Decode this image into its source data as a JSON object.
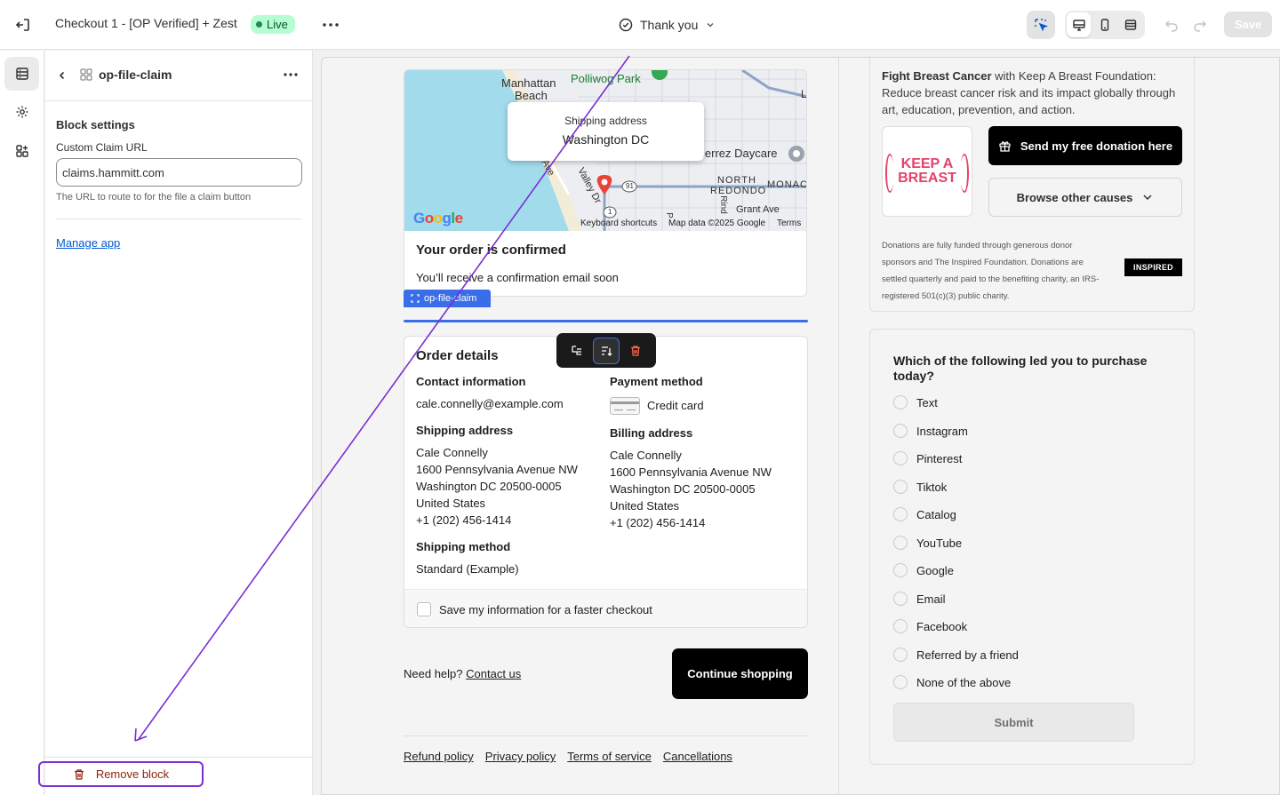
{
  "topbar": {
    "title": "Checkout 1 - [OP Verified] + Zest",
    "status_badge": "Live",
    "page_selector": "Thank you",
    "save_label": "Save"
  },
  "panel": {
    "block_name": "op-file-claim",
    "settings_title": "Block settings",
    "field_label": "Custom Claim URL",
    "field_value": "claims.hammitt.com",
    "field_help": "The URL to route to for the file a claim button",
    "manage_app": "Manage app",
    "remove_block": "Remove block"
  },
  "map": {
    "bubble_label": "Shipping address",
    "bubble_city": "Washington DC",
    "labels": {
      "manhattan": "Manhattan",
      "beach": "Beach",
      "polliwog": "Polliwog Park",
      "daycare": "ierrez Daycare",
      "north": "NORTH",
      "redondo": "REDONDO",
      "monac": "MONAC",
      "grant": "Grant Ave",
      "valley": "Valley Dr",
      "ave": "Ave",
      "rind": "Rind",
      "route": "91",
      "route2": "1",
      "l": "L",
      "p": "P"
    },
    "google": "Google",
    "attr_shortcuts": "Keyboard shortcuts",
    "attr_data": "Map data ©2025 Google",
    "attr_terms": "Terms"
  },
  "confirmation": {
    "title": "Your order is confirmed",
    "subtitle": "You’ll receive a confirmation email soon"
  },
  "block_tag": "op-file-claim",
  "order": {
    "title": "Order details",
    "contact_heading": "Contact information",
    "contact_email": "cale.connelly@example.com",
    "payment_heading": "Payment method",
    "payment_value": "Credit card",
    "shipping_heading": "Shipping address",
    "shipping_lines": [
      "Cale Connelly",
      "1600 Pennsylvania Avenue NW",
      "Washington DC 20500-0005",
      "United States",
      "+1 (202) 456-1414"
    ],
    "billing_heading": "Billing address",
    "billing_lines": [
      "Cale Connelly",
      "1600 Pennsylvania Avenue NW",
      "Washington DC 20500-0005",
      "United States",
      "+1 (202) 456-1414"
    ],
    "method_heading": "Shipping method",
    "method_value": "Standard (Example)",
    "save_info": "Save my information for a faster checkout"
  },
  "help": {
    "prefix": "Need help?",
    "link": "Contact us"
  },
  "continue_label": "Continue shopping",
  "footer_links": [
    "Refund policy",
    "Privacy policy",
    "Terms of service",
    "Cancellations"
  ],
  "donation": {
    "org_bold": "Fight Breast Cancer",
    "org_rest": " with Keep A Breast Foundation: Reduce breast cancer risk and its impact globally through art, education, prevention, and action.",
    "logo_line1": "KEEP A",
    "logo_line2": "BREAST",
    "send_label": "Send my free donation here",
    "browse_label": "Browse other causes",
    "fine_print": "Donations are fully funded through generous donor sponsors and The Inspired Foundation. Donations are settled quarterly and paid to the benefiting charity, an IRS-registered 501(c)(3) public charity.",
    "inspired_logo": "INSPIRED"
  },
  "survey": {
    "question": "Which of the following led you to purchase today?",
    "options": [
      "Text",
      "Instagram",
      "Pinterest",
      "Tiktok",
      "Catalog",
      "YouTube",
      "Google",
      "Email",
      "Facebook",
      "Referred by a friend",
      "None of the above"
    ],
    "submit_label": "Submit"
  },
  "colors": {
    "accent": "#3a6ee8",
    "annotation_arrow": "#7b2fd0",
    "live_badge_bg": "#b4fed2",
    "live_badge_text": "#0c5132",
    "keep_a_breast_pink": "#e3426a"
  }
}
